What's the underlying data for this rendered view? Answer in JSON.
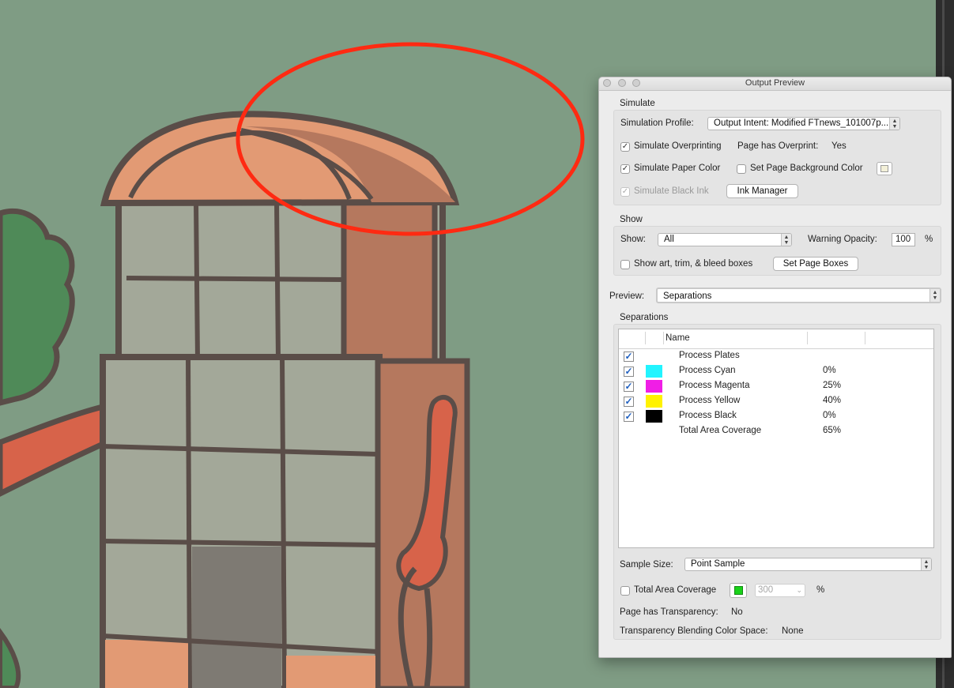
{
  "panel": {
    "title": "Output Preview",
    "simulate": {
      "section_title": "Simulate",
      "profile_label": "Simulation Profile:",
      "profile_value": "Output Intent: Modified FTnews_101007p...",
      "overprint_label": "Simulate Overprinting",
      "overprint_checked": true,
      "page_overprint_label": "Page has Overprint:",
      "page_overprint_value": "Yes",
      "paper_color_label": "Simulate Paper Color",
      "paper_color_checked": true,
      "bg_color_label": "Set Page Background Color",
      "bg_color_checked": false,
      "black_ink_label": "Simulate Black Ink",
      "black_ink_checked": true,
      "ink_manager_label": "Ink Manager"
    },
    "show": {
      "section_title": "Show",
      "show_label": "Show:",
      "show_value": "All",
      "warning_label": "Warning Opacity:",
      "warning_value": "100",
      "warning_unit": "%",
      "boxes_label": "Show art, trim, & bleed boxes",
      "boxes_checked": false,
      "page_boxes_label": "Set Page Boxes"
    },
    "preview": {
      "label": "Preview:",
      "value": "Separations"
    },
    "separations": {
      "section_title": "Separations",
      "col_name": "Name",
      "rows": [
        {
          "name": "Process Plates",
          "pct": "",
          "color": "",
          "checked": true
        },
        {
          "name": "Process Cyan",
          "pct": "0%",
          "color": "#22f4ff",
          "checked": true
        },
        {
          "name": "Process Magenta",
          "pct": "25%",
          "color": "#f01ee6",
          "checked": true
        },
        {
          "name": "Process Yellow",
          "pct": "40%",
          "color": "#fff200",
          "checked": true
        },
        {
          "name": "Process Black",
          "pct": "0%",
          "color": "#000000",
          "checked": true
        },
        {
          "name": "Total Area Coverage",
          "pct": "65%",
          "color": "",
          "checked": false
        }
      ]
    },
    "sample_size": {
      "label": "Sample Size:",
      "value": "Point Sample"
    },
    "tac": {
      "label": "Total Area Coverage",
      "checked": false,
      "swatch_color": "#19d219",
      "value": "300",
      "unit": "%"
    },
    "transparency": {
      "label": "Page has Transparency:",
      "value": "No"
    },
    "blending": {
      "label": "Transparency Blending Color Space:",
      "value": "None"
    }
  },
  "colors": {
    "background": "#7f9c84",
    "annotation_circle": "#ff2a12",
    "roof": "#e29a74",
    "roof_shaded": "#b5785e",
    "windows": "#a3a899",
    "outline": "#5a4d48"
  }
}
